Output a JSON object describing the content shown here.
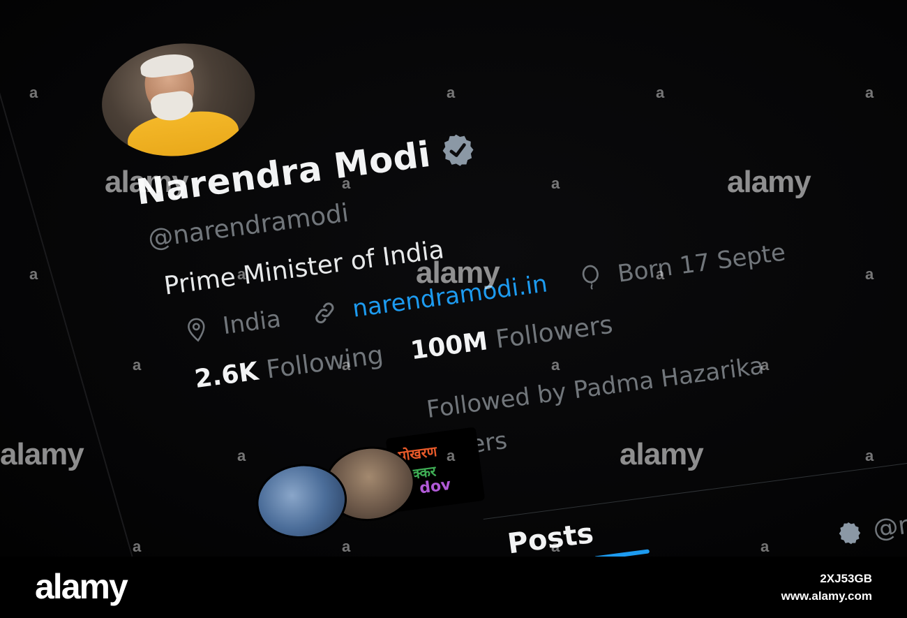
{
  "profile": {
    "name": "Narendra Modi",
    "handle": "@narendramodi",
    "bio": "Prime Minister of India",
    "location": "India",
    "website": "narendramodi.in",
    "birth": "Born 17 Septe",
    "following_count": "2.6K",
    "following_label": "Following",
    "followers_count": "100M",
    "followers_label": "Followers",
    "followed_by_line1": "Followed by Padma Hazarika",
    "followed_by_line2": "others"
  },
  "followed_by_avatars": {
    "third_text_1": "पोखरण",
    "third_text_2": "टक्कर",
    "third_text_3": "dov"
  },
  "tabs": {
    "posts": "Posts"
  },
  "post_header": {
    "handle_partial": "@na"
  },
  "watermark": {
    "text": "alamy",
    "footer_logo": "alamy",
    "image_id": "2XJ53GB",
    "url": "www.alamy.com"
  },
  "colors": {
    "background": "#000000",
    "accent": "#1d9bf0",
    "text_primary": "#e7e9ea",
    "text_secondary": "#71767b",
    "verified_badge": "#8b98a5"
  },
  "icons": {
    "verified": "verified-badge-icon",
    "location": "location-pin-icon",
    "link": "link-icon",
    "birthday": "balloon-icon"
  }
}
